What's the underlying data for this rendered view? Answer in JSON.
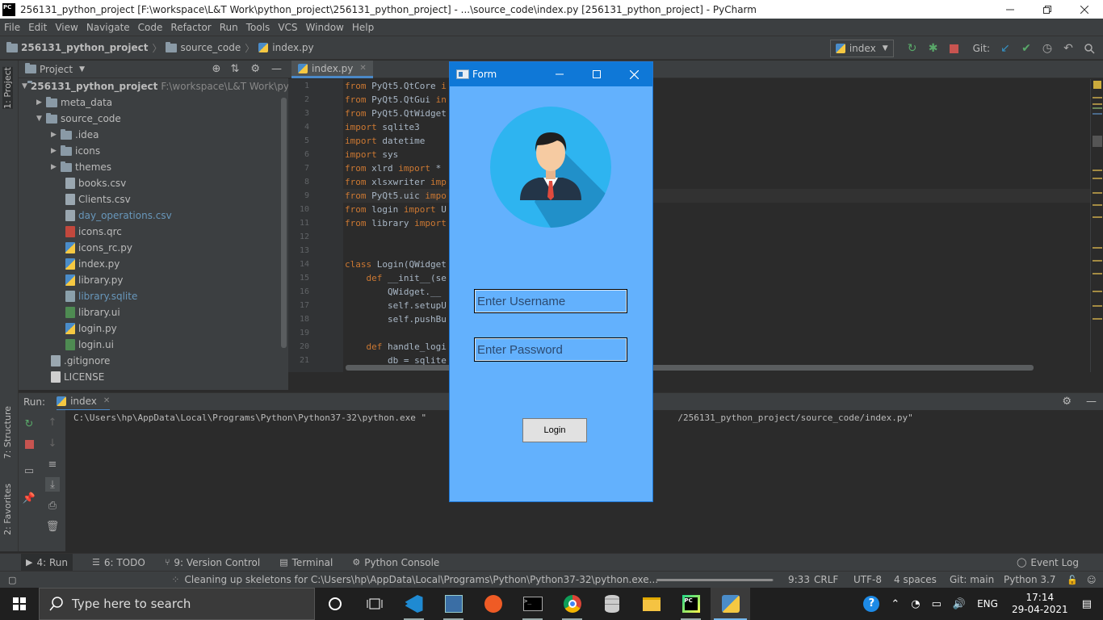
{
  "window": {
    "title": "256131_python_project [F:\\workspace\\L&T Work\\python_project\\256131_python_project] - ...\\source_code\\index.py [256131_python_project] - PyCharm",
    "logo_text": "PC"
  },
  "menu": [
    "File",
    "Edit",
    "View",
    "Navigate",
    "Code",
    "Refactor",
    "Run",
    "Tools",
    "VCS",
    "Window",
    "Help"
  ],
  "breadcrumb": [
    "256131_python_project",
    "source_code",
    "index.py"
  ],
  "toolbar": {
    "run_config": "index",
    "git_label": "Git:"
  },
  "left_strip": {
    "project": "1: Project",
    "structure": "7: Structure",
    "favorites": "2: Favorites"
  },
  "project_panel": {
    "title": "Project",
    "root": "256131_python_project",
    "root_path": "F:\\workspace\\L&T Work\\pytho",
    "items": [
      {
        "label": "meta_data",
        "type": "folder"
      },
      {
        "label": "source_code",
        "type": "folder"
      },
      {
        "label": ".idea",
        "type": "folder"
      },
      {
        "label": "icons",
        "type": "folder"
      },
      {
        "label": "themes",
        "type": "folder"
      },
      {
        "label": "books.csv",
        "type": "csv"
      },
      {
        "label": "Clients.csv",
        "type": "csv"
      },
      {
        "label": "day_operations.csv",
        "type": "csv"
      },
      {
        "label": "icons.qrc",
        "type": "qrc"
      },
      {
        "label": "icons_rc.py",
        "type": "py"
      },
      {
        "label": "index.py",
        "type": "py"
      },
      {
        "label": "library.py",
        "type": "py"
      },
      {
        "label": "library.sqlite",
        "type": "sqlite"
      },
      {
        "label": "library.ui",
        "type": "ui"
      },
      {
        "label": "login.py",
        "type": "py"
      },
      {
        "label": "login.ui",
        "type": "ui"
      },
      {
        "label": ".gitignore",
        "type": "git"
      },
      {
        "label": "LICENSE",
        "type": "lic"
      }
    ]
  },
  "editor": {
    "tab": "index.py",
    "line_numbers": [
      "1",
      "2",
      "3",
      "4",
      "5",
      "6",
      "7",
      "8",
      "9",
      "10",
      "11",
      "12",
      "13",
      "14",
      "15",
      "16",
      "17",
      "18",
      "19",
      "20",
      "21"
    ],
    "lines": [
      [
        [
          "kw",
          "from"
        ],
        [
          "t",
          " PyQt5.QtCore "
        ],
        [
          "kw",
          "i"
        ]
      ],
      [
        [
          "kw",
          "from"
        ],
        [
          "t",
          " PyQt5.QtGui "
        ],
        [
          "kw",
          "in"
        ]
      ],
      [
        [
          "kw",
          "from"
        ],
        [
          "t",
          " PyQt5.QtWidget"
        ]
      ],
      [
        [
          "kw",
          "import"
        ],
        [
          "t",
          " sqlite3"
        ]
      ],
      [
        [
          "kw",
          "import"
        ],
        [
          "t",
          " datetime"
        ]
      ],
      [
        [
          "kw",
          "import"
        ],
        [
          "t",
          " sys"
        ]
      ],
      [
        [
          "kw",
          "from"
        ],
        [
          "t",
          " xlrd "
        ],
        [
          "kw",
          "import"
        ],
        [
          "t",
          " *"
        ]
      ],
      [
        [
          "kw",
          "from"
        ],
        [
          "t",
          " xlsxwriter "
        ],
        [
          "kw",
          "imp"
        ]
      ],
      [
        [
          "kw",
          "from"
        ],
        [
          "t",
          " PyQt5.uic "
        ],
        [
          "kw",
          "impo"
        ]
      ],
      [
        [
          "kw",
          "from"
        ],
        [
          "t",
          " login "
        ],
        [
          "kw",
          "import"
        ],
        [
          "t",
          " U"
        ]
      ],
      [
        [
          "kw",
          "from"
        ],
        [
          "t",
          " library "
        ],
        [
          "kw",
          "import"
        ]
      ],
      [],
      [],
      [
        [
          "kw",
          "class"
        ],
        [
          "t",
          " Login(QWidget"
        ]
      ],
      [
        [
          "t",
          "    "
        ],
        [
          "kw",
          "def"
        ],
        [
          "t",
          " __init__(se"
        ]
      ],
      [
        [
          "t",
          "        QWidget.__"
        ]
      ],
      [
        [
          "t",
          "        self.setupU"
        ]
      ],
      [
        [
          "t",
          "        self.pushBu                          .login)"
        ]
      ],
      [],
      [
        [
          "t",
          "    "
        ],
        [
          "kw",
          "def"
        ],
        [
          "t",
          " handle_logi"
        ]
      ],
      [
        [
          "t",
          "        db = sqlite"
        ]
      ]
    ]
  },
  "run_panel": {
    "label": "Run:",
    "tab": "index",
    "console": "C:\\Users\\hp\\AppData\\Local\\Programs\\Python\\Python37-32\\python.exe \"                                               /256131_python_project/source_code/index.py\""
  },
  "bottom_tabs": [
    {
      "label": "4: Run",
      "icon": "play-icon"
    },
    {
      "label": "6: TODO",
      "icon": "todo-icon"
    },
    {
      "label": "9: Version Control",
      "icon": "vcs-icon"
    },
    {
      "label": "Terminal",
      "icon": "terminal-icon"
    },
    {
      "label": "Python Console",
      "icon": "python-console-icon"
    }
  ],
  "event_log": "Event Log",
  "status": {
    "message": "Cleaning up skeletons for C:\\Users\\hp\\AppData\\Local\\Programs\\Python\\Python37-32\\python.exe...",
    "progress_fraction": 0.99,
    "position": "9:33",
    "line_sep": "CRLF",
    "encoding": "UTF-8",
    "indent": "4 spaces",
    "git": "Git: main",
    "interpreter": "Python 3.7"
  },
  "form": {
    "title": "Form",
    "username_placeholder": "Enter Username",
    "password_placeholder": "Enter Password",
    "login_label": "Login"
  },
  "taskbar": {
    "search_placeholder": "Type here to search",
    "language": "ENG",
    "time": "17:14",
    "date": "29-04-2021"
  },
  "colors": {
    "ide_bg": "#2b2b2b",
    "ide_panel": "#3c3f41",
    "form_bg": "#63b1fd",
    "form_titlebar": "#0f78d7",
    "keyword": "#cc7832",
    "code_text": "#a9b7c6"
  }
}
